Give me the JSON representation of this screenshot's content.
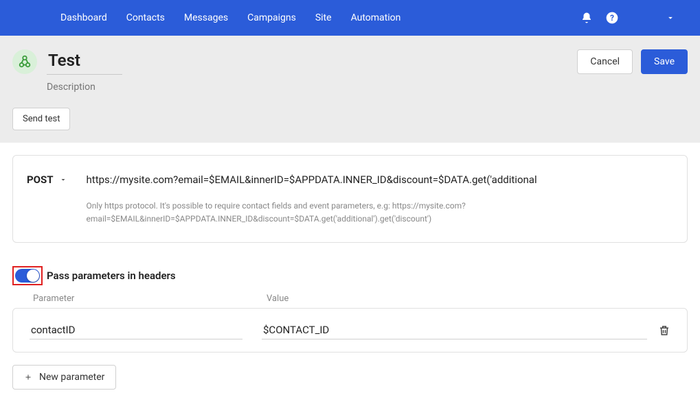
{
  "nav": {
    "items": [
      "Dashboard",
      "Contacts",
      "Messages",
      "Campaigns",
      "Site",
      "Automation"
    ]
  },
  "header": {
    "title": "Test",
    "description_placeholder": "Description",
    "cancel_label": "Cancel",
    "save_label": "Save",
    "send_test_label": "Send test"
  },
  "request": {
    "method": "POST",
    "url": "https://mysite.com?email=$EMAIL&innerID=$APPDATA.INNER_ID&discount=$DATA.get('additional",
    "hint": "Only https protocol. It's possible to require contact fields and event parameters, e.g: https://mysite.com?email=$EMAIL&innerID=$APPDATA.INNER_ID&discount=$DATA.get('additional').get('discount')"
  },
  "headers_section": {
    "toggle_label": "Pass parameters in headers",
    "toggle_on": true,
    "col_parameter": "Parameter",
    "col_value": "Value",
    "rows": [
      {
        "name": "contactID",
        "value": "$CONTACT_ID"
      }
    ],
    "new_param_label": "New parameter"
  }
}
